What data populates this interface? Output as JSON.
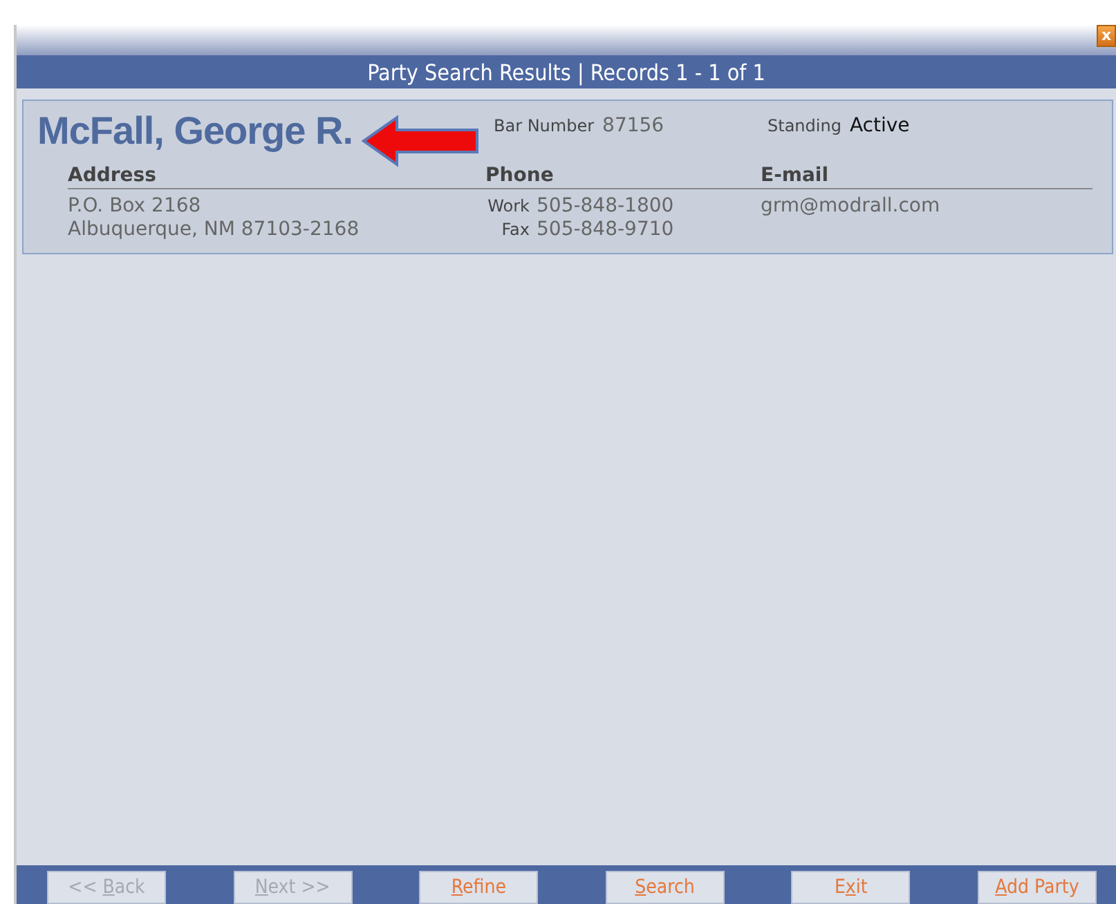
{
  "window": {
    "close_label": "x"
  },
  "header": {
    "title": "Party Search Results | Records 1 - 1 of 1"
  },
  "result": {
    "name": "McFall, George R.",
    "bar_number_label": "Bar Number",
    "bar_number": "87156",
    "standing_label": "Standing",
    "standing": "Active",
    "columns": [
      "Address",
      "Phone",
      "E-mail"
    ],
    "address_lines": [
      "P.O. Box 2168",
      "Albuquerque, NM 87103-2168"
    ],
    "phones": [
      {
        "label": "Work",
        "number": "505-848-1800"
      },
      {
        "label": "Fax",
        "number": "505-848-9710"
      }
    ],
    "email": "grm@modrall.com"
  },
  "buttons": [
    {
      "before": "<< ",
      "key": "B",
      "after": "ack",
      "disabled": true
    },
    {
      "key": "N",
      "after": "ext >>",
      "disabled": true
    },
    {
      "key": "R",
      "after": "efine",
      "disabled": false
    },
    {
      "key": "S",
      "after": "earch",
      "disabled": false
    },
    {
      "before": "E",
      "key": "x",
      "after": "it",
      "disabled": false
    },
    {
      "key": "A",
      "after": "dd Party",
      "disabled": false
    }
  ]
}
